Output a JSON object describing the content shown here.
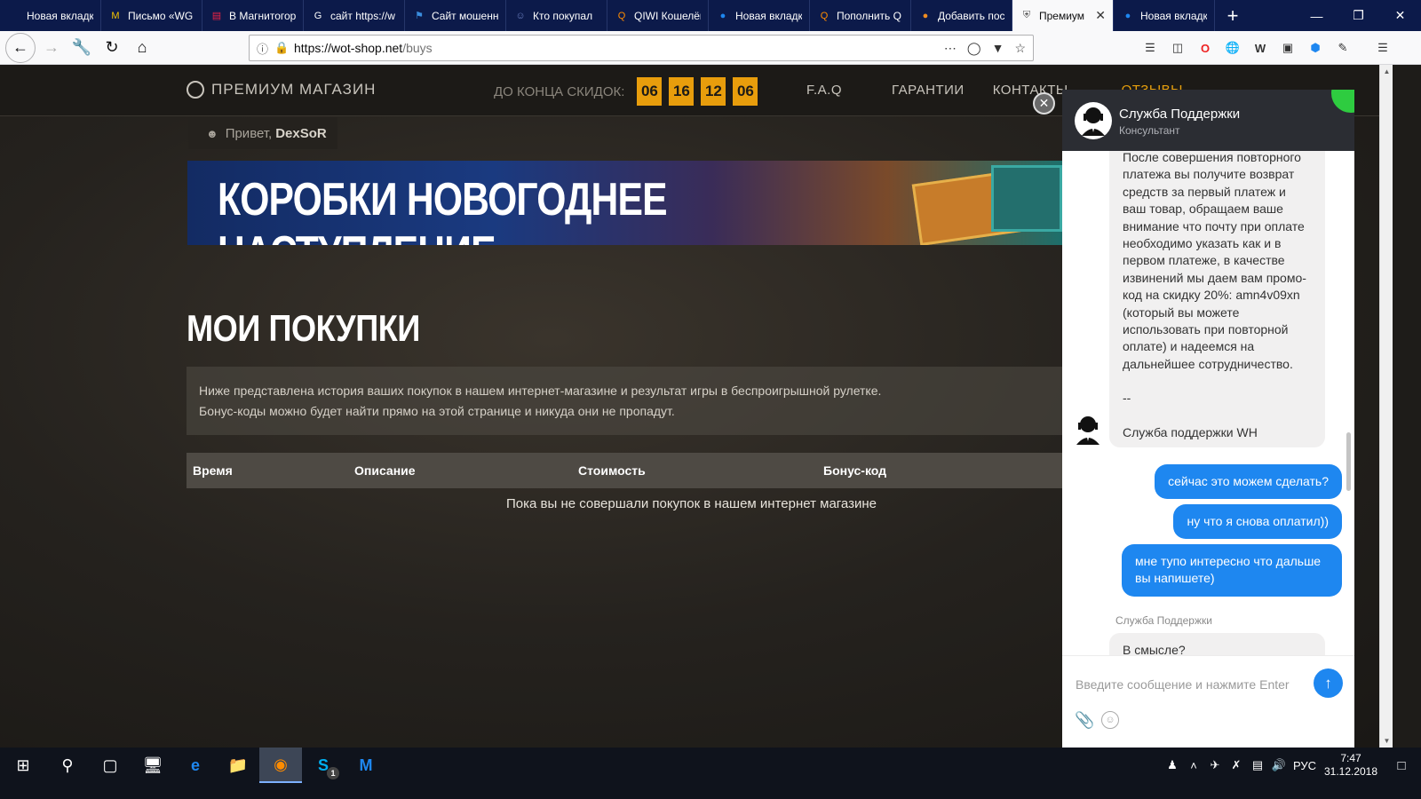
{
  "browser": {
    "tabs": [
      {
        "label": "Новая вкладка",
        "icon": "globe-icon",
        "color": "#0c1a4a"
      },
      {
        "label": "Письмо «WG",
        "icon": "mail-icon",
        "color": "#f5c400"
      },
      {
        "label": "В Магнитогор",
        "icon": "news-icon",
        "color": "#e24"
      },
      {
        "label": "сайт https://w",
        "icon": "google-icon",
        "color": "#fff"
      },
      {
        "label": "Сайт мошенн",
        "icon": "flag-icon",
        "color": "#3a8dde"
      },
      {
        "label": "Кто покупал",
        "icon": "forum-icon",
        "color": "#6a7fbf"
      },
      {
        "label": "QIWI Кошелёк",
        "icon": "qiwi-icon",
        "color": "#ff8c00"
      },
      {
        "label": "Новая вкладк",
        "icon": "firefox-icon",
        "color": "#1e87f0"
      },
      {
        "label": "Пополнить Q",
        "icon": "qiwi-icon",
        "color": "#ff8c00"
      },
      {
        "label": "Добавить пос",
        "icon": "orange-icon",
        "color": "#f08c20"
      },
      {
        "label": "Премиум",
        "icon": "shield-icon",
        "color": "#555",
        "active": true
      },
      {
        "label": "Новая вкладк",
        "icon": "firefox-icon",
        "color": "#1e87f0"
      }
    ],
    "url_host": "https://wot-shop.net",
    "url_path": "/buys"
  },
  "site": {
    "logo": "ПРЕМИУМ МАГАЗИН",
    "countdown_label": "ДО КОНЦА СКИДОК:",
    "countdown": [
      "06",
      "16",
      "12",
      "06"
    ],
    "nav": [
      "F.A.Q",
      "ГАРАНТИИ",
      "КОНТАКТЫ",
      "ОТЗЫВЫ"
    ],
    "greeting": "Привет,",
    "username": "DexSoR",
    "banner": "КОРОБКИ НОВОГОДНЕЕ НАСТУПЛЕНИЕ",
    "page_title": "МОИ ПОКУПКИ",
    "info_line1": "Ниже представлена история ваших покупок в нашем интернет-магазине и результат игры в беспроигрышной рулетке.",
    "info_line2": "Бонус-коды можно будет найти прямо на этой странице и никуда они не пропадут.",
    "table_headers": [
      "Время",
      "Описание",
      "Стоимость",
      "Бонус-код"
    ],
    "empty_message": "Пока вы не совершали покупок в нашем интернет магазине"
  },
  "chat": {
    "agent_name": "Служба Поддержки",
    "agent_role": "Консультант",
    "incoming_1": "После совершения повторного платежа вы получите возврат средств за первый платеж и ваш товар, обращаем ваше внимание что почту при оплате необходимо указать как и в первом платеже, в качестве извинений мы даем вам промо-код на скидку 20%: amn4v09xn (который вы можете использовать при повторной оплате) и надеемся на дальнейшее сотрудничество.",
    "incoming_1_sep": "--",
    "incoming_1_sig": "Служба поддержки WH",
    "outgoing": [
      "сейчас это можем сделать?",
      "ну что я снова оплатил))",
      "мне тупо интересно что дальше вы напишете)"
    ],
    "agent_name_2": "Служба Поддержки",
    "incoming_2": "В смысле?",
    "input_placeholder": "Введите сообщение и нажмите Enter"
  },
  "taskbar": {
    "apps": [
      "start-icon",
      "search-icon",
      "task-view-icon",
      "network-app-icon",
      "edge-icon",
      "explorer-icon",
      "firefox-icon",
      "skype-icon",
      "malwarebytes-icon"
    ],
    "skype_badge": "1",
    "lang": "РУС",
    "time": "7:47",
    "date": "31.12.2018"
  }
}
